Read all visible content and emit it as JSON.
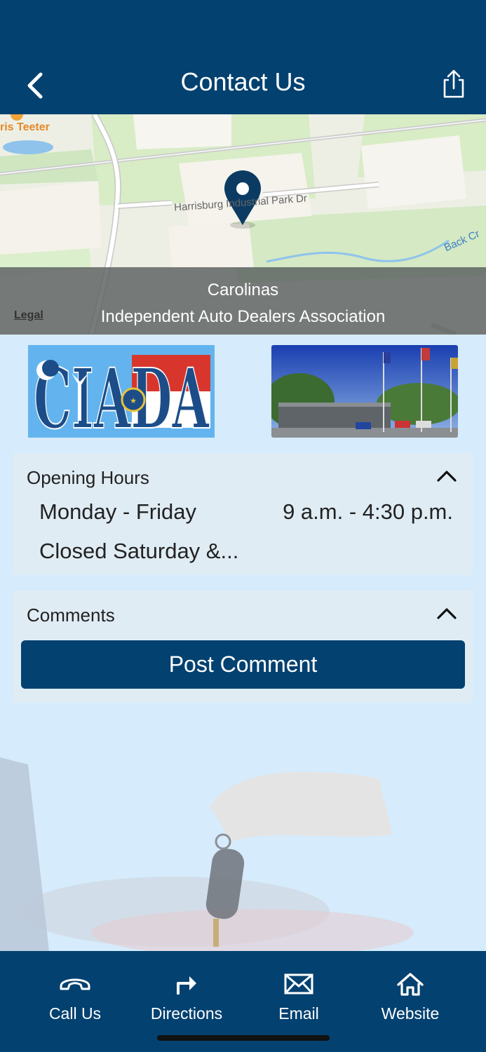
{
  "header": {
    "title": "Contact Us",
    "back_icon": "chevron-left-icon",
    "share_icon": "share-icon"
  },
  "map": {
    "poi_label": "ris Teeter",
    "road_label": "Harrisburg Industrial Park Dr",
    "creek_label": "Back Cr",
    "location_name_line1": "Carolinas",
    "location_name_line2": "Independent Auto Dealers Association",
    "legal_link": "Legal",
    "pin_icon": "map-pin-icon"
  },
  "logo": {
    "text": "CIADA"
  },
  "opening_hours": {
    "title": "Opening Hours",
    "rows": [
      {
        "day": "Monday - Friday",
        "time": "9 a.m. - 4:30 p.m."
      },
      {
        "day": "Closed Saturday &...",
        "time": ""
      }
    ]
  },
  "comments": {
    "title": "Comments",
    "post_button": "Post Comment"
  },
  "tabbar": {
    "items": [
      {
        "label": "Call Us",
        "icon": "phone-icon"
      },
      {
        "label": "Directions",
        "icon": "directions-icon"
      },
      {
        "label": "Email",
        "icon": "email-icon"
      },
      {
        "label": "Website",
        "icon": "home-icon"
      }
    ]
  },
  "colors": {
    "brand": "#034170",
    "background": "#d6ebfb"
  }
}
